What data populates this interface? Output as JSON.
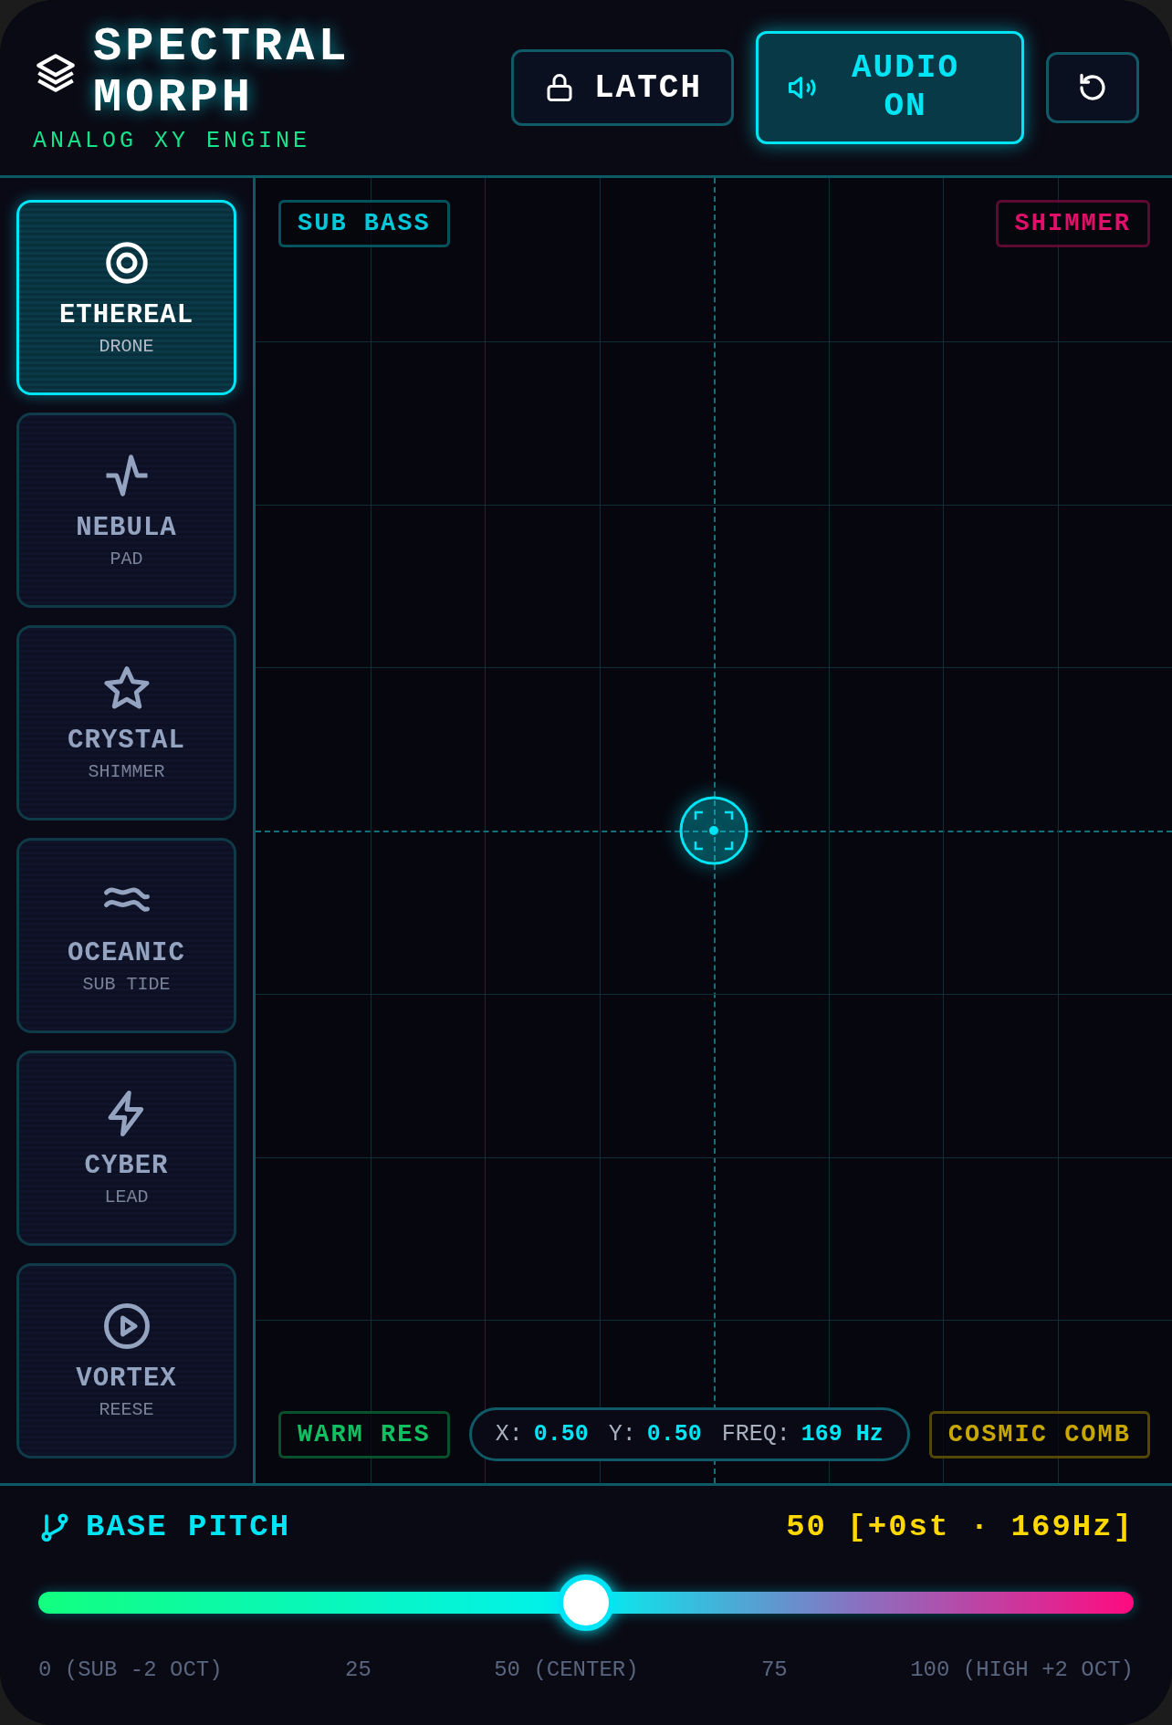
{
  "header": {
    "title": "SPECTRAL MORPH",
    "subtitle": "ANALOG XY ENGINE",
    "latch": {
      "label": "LATCH",
      "on": false
    },
    "audio": {
      "label": "AUDIO ON",
      "on": true
    }
  },
  "presets": [
    {
      "kind": "target",
      "name": "ETHEREAL",
      "sub": "DRONE",
      "selected": true
    },
    {
      "kind": "pulse",
      "name": "NEBULA",
      "sub": "PAD",
      "selected": false
    },
    {
      "kind": "star",
      "name": "CRYSTAL",
      "sub": "SHIMMER",
      "selected": false
    },
    {
      "kind": "waves",
      "name": "OCEANIC",
      "sub": "SUB TIDE",
      "selected": false
    },
    {
      "kind": "bolt",
      "name": "CYBER",
      "sub": "LEAD",
      "selected": false
    },
    {
      "kind": "play",
      "name": "VORTEX",
      "sub": "REESE",
      "selected": false
    }
  ],
  "pad": {
    "corners": [
      {
        "label": "SUB BASS",
        "color": "#00c8d8"
      },
      {
        "label": "SHIMMER",
        "color": "#e0106a"
      },
      {
        "label": "WARM RES",
        "color": "#10c060"
      },
      {
        "label": "COSMIC COMB",
        "color": "#c8a800"
      }
    ],
    "readout": {
      "x_label": "X:",
      "x_value": "0.50",
      "y_label": "Y:",
      "y_value": "0.50",
      "freq_label": "FREQ:",
      "freq_value": "169 Hz"
    }
  },
  "pitch": {
    "label": "BASE PITCH",
    "value": "50 [+0st · 169Hz]",
    "level": 0.5,
    "ticks": [
      "0 (SUB -2 OCT)",
      "25",
      "50 (CENTER)",
      "75",
      "100 (HIGH +2 OCT)"
    ]
  }
}
